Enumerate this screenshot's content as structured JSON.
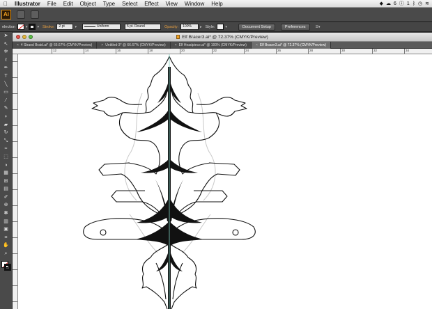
{
  "menubar": {
    "apple": "",
    "app_name": "Illustrator",
    "items": [
      "File",
      "Edit",
      "Object",
      "Type",
      "Select",
      "Effect",
      "View",
      "Window",
      "Help"
    ],
    "status": {
      "badge_count": "6",
      "notif_count": "1"
    }
  },
  "appbar": {
    "logo": "Ai",
    "br_label": "Br"
  },
  "control": {
    "selection_label": "election",
    "stroke_label": "Stroke:",
    "stroke_value": "2 pt",
    "profile_label": "Uniform",
    "brush_label": "5 pt. Round",
    "opacity_label": "Opacity:",
    "opacity_value": "100%",
    "style_label": "Style:",
    "doc_setup_label": "Document Setup",
    "prefs_label": "Preferences"
  },
  "window": {
    "title": "Elf Bracer3.ai* @ 72.37% (CMYK/Preview)",
    "light_colors": [
      "#e8524a",
      "#e5b73a",
      "#5bbf45"
    ]
  },
  "tabs": [
    {
      "label": "4 Strand Braid.ai* @ 66.67% (CMYK/Preview)",
      "active": false
    },
    {
      "label": "Untitled-3* @ 66.67% (CMYK/Preview)",
      "active": false
    },
    {
      "label": "Elf Headpiece.ai* @ 100% (CMYK/Preview)",
      "active": false
    },
    {
      "label": "Elf Bracer3.ai* @ 72.37% (CMYK/Preview)",
      "active": true
    }
  ],
  "ruler": {
    "labels": [
      "12",
      "14",
      "16",
      "18",
      "20",
      "22",
      "24",
      "26",
      "28",
      "30",
      "32",
      "34",
      "36"
    ]
  },
  "tools": [
    "selection-arrow",
    "direct-selection",
    "magic-wand",
    "lasso",
    "pen",
    "type",
    "line-segment",
    "rectangle",
    "paintbrush",
    "pencil",
    "blob-brush",
    "eraser",
    "rotate",
    "scale",
    "width",
    "free-transform",
    "shape-builder",
    "perspective-grid",
    "mesh",
    "gradient",
    "eyedropper",
    "blend",
    "symbol-sprayer",
    "column-graph",
    "artboard",
    "slice",
    "hand",
    "zoom"
  ],
  "colors": {
    "accent": "#e8a040",
    "art_stroke": "#111111",
    "center_line": "#7ecfc0"
  }
}
